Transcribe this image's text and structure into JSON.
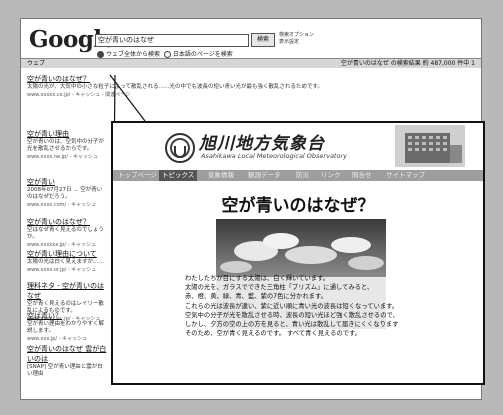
{
  "google": {
    "logo": "Google",
    "search_value": "空が青いのはなぜ",
    "search_button": "検索",
    "options": [
      "検索オプション",
      "表示設定"
    ],
    "radio_web": "ウェブ全体から検索",
    "radio_jp": "日本語のページを検索",
    "web_tab": "ウェブ",
    "stats": "空が青いのはなぜ の検索結果 約 487,000 件中 1",
    "results": [
      {
        "title": "空が青いのはなぜ？",
        "text": "太陽の光が、大気中の小さな粒子によって散乱される……光の中でも波長の短い青い光が最も強く散乱されるためです。",
        "url": "www.xxxxx.co.jp/ - キャッシュ - 関連ページ"
      },
      {
        "title": "空が青い理由",
        "text": "空が青いのは、空気中の分子が光を散乱させるからです。",
        "url": "www.xxxx.ne.jp/ - キャッシュ"
      },
      {
        "title": "空が青い",
        "text": "2008年07月27日 ... 空が青いのはなぜだろう。",
        "url": "www.xxxx.com/ - キャッシュ"
      },
      {
        "title": "空が青いのはなぜ？",
        "text": "空はなぜ青く見えるのでしょうか。",
        "url": "www.xxxxxx.jp/ - キャッシュ"
      },
      {
        "title": "空が青い理由について",
        "text": "太陽の光は白く見えますが……",
        "url": "www.xxxx.or.jp/ - キャッシュ"
      },
      {
        "title": "理科ネタ - 空が青いのはなぜ",
        "text": "空が青く見えるのはレイリー散乱によるものです。",
        "url": "www.xxxxx.ac.jp/ - キャッシュ"
      },
      {
        "title": "空は青い？",
        "text": "空が青い理由をわかりやすく解説します。",
        "url": "www.xxx.jp/ - キャッシュ"
      },
      {
        "title": "空が青いのはなぜ 雲が白いのは",
        "text": "[SNAP] 空が青い理由と雲が白い理由",
        "url": ""
      }
    ]
  },
  "site": {
    "title": "旭川地方気象台",
    "subtitle": "Asahikawa Local Meteorological Observatory",
    "nav": [
      "トップページ",
      "トピックス",
      "気象情報",
      "観測データ",
      "防災",
      "リンク",
      "問合せ",
      "サイトマップ"
    ],
    "heading": "空が青いのはなぜ？",
    "body": [
      "わたしたちが目にする太陽は、白く輝いています。",
      "太陽の光を、ガラスでできた三角柱「プリズム」に通してみると、",
      "赤、橙、黄、緑、青、藍、紫の7色に分かれます。",
      "これらの光は波長が違い、紫に近い順に青い光の波長は短くなっています。",
      "空気中の分子が光を散乱させる時、波長の短い光ほど強く散乱させるので、",
      "しかし、夕方の空の上の方を見ると、青い光は散乱して届きにくくなります",
      "そのため、空が青く見えるのです。 すべて青く見えるのです。"
    ]
  }
}
